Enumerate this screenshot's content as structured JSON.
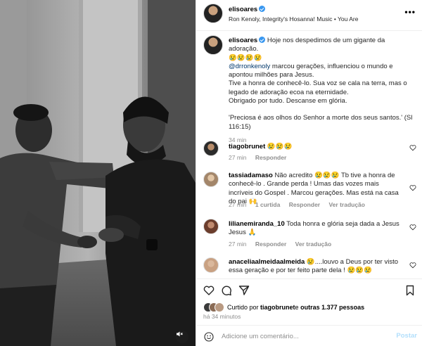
{
  "post": {
    "username": "elisoares",
    "audio": "Ron Kenoly, Integrity's Hosanna! Music • You Are"
  },
  "caption": {
    "username": "elisoares",
    "line1": "Hoje nos despedimos de um gigante da adoração.",
    "emojis": "😢😢😢😢",
    "mention": "@drronkenoly",
    "line2": " marcou gerações, influenciou o mundo e apontou milhões para Jesus.",
    "line3": "Tive a honra de conhecê-lo. Sua voz se cala na terra, mas o legado de adoração ecoa na eternidade.",
    "line4": "Obrigado por tudo. Descanse em glória.",
    "verse": "'Preciosa é aos olhos do Senhor a morte dos seus santos.' (Sl 116:15)",
    "time": "34 min"
  },
  "comments": [
    {
      "username": "tiagobrunet",
      "text": "😢😢😢",
      "time": "27 min",
      "reply": "Responder",
      "likes": "",
      "translate": ""
    },
    {
      "username": "tassiadamaso",
      "text": "Não acredito 😢😢😢 Tb tive a honra de conhecê-lo . Grande perda ! Umas das vozes mais incríveis do Gospel . Marcou gerações. Mas está na casa do pai 🙌",
      "time": "27 min",
      "likes": "1 curtida",
      "reply": "Responder",
      "translate": "Ver tradução"
    },
    {
      "username": "lilianemiranda_10",
      "text": "Toda honra e glória seja dada a Jesus Jesus 🙏",
      "time": "27 min",
      "reply": "Responder",
      "translate": "Ver tradução",
      "likes": ""
    },
    {
      "username": "anaceliaalmeidaalmeida",
      "text": "😢....louvo a Deus por ter visto essa geração e por ter feito parte dela ! 😢😢😢",
      "time": "",
      "reply": "",
      "translate": "",
      "likes": ""
    }
  ],
  "likes": {
    "prefix": "Curtido por ",
    "user": "tiagobrunet",
    "middle": " e ",
    "others": "outras 1.377 pessoas"
  },
  "posted": "há 34 minutos",
  "add_comment": {
    "placeholder": "Adicione um comentário...",
    "post_label": "Postar"
  },
  "colors": {
    "verified": "#3897f0",
    "meta": "#8e8e8e",
    "mention": "#00376b",
    "post_disabled": "#b2dffc"
  }
}
